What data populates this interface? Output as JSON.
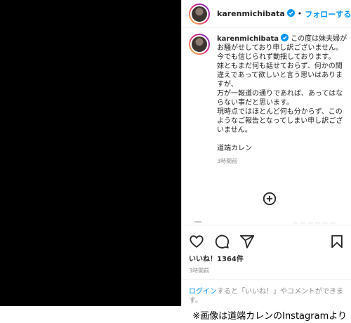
{
  "header": {
    "username": "karenmichibata",
    "separator": "•",
    "follow_label": "フォローする",
    "icons": [
      "avatar",
      "verified-badge-icon"
    ]
  },
  "caption": {
    "username": "karenmichibata",
    "text": " この度は妹夫婦がお騒がせしており申し訳ございません。\n今でも信じられず動揺しております。\n妹ともまだ何も話せておらず、何かの間違えであって欲しいと言う思いはありますが、\n万が一報道の通りであれば、あってはならない事だと思います。\n現時点ではほとんど何も分からず、このようなご報告となってしまい申し訳ございません。\n\n道端カレン",
    "time": "3時間前"
  },
  "more_comments_icon": "plus-circle-icon",
  "reply_stub": {
    "dots": "— — — — — —"
  },
  "actions": {
    "icons": [
      "heart-icon",
      "comment-icon",
      "share-icon",
      "bookmark-icon"
    ]
  },
  "likes": "いいね！1364件",
  "post_time": "3時間前",
  "login": {
    "link": "ログイン",
    "text": "すると「いいね！」やコメントができます。"
  },
  "credit": "※画像は道端カレンのInstagramより",
  "colors": {
    "accent": "#0095f6",
    "muted": "#8e8e8e",
    "text": "#262626",
    "media_bg": "#000000"
  }
}
